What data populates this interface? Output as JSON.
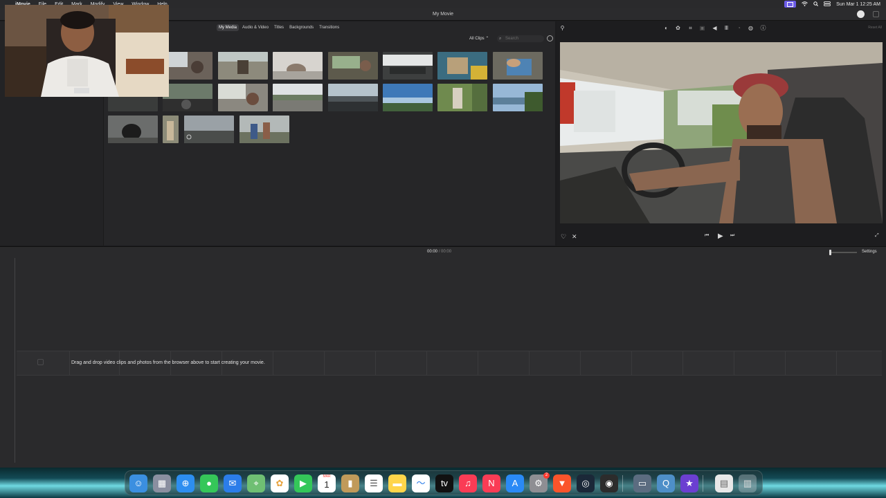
{
  "menubar": {
    "apple_icon": "apple-icon",
    "app_name": "iMovie",
    "items": [
      "File",
      "Edit",
      "Mark",
      "Modify",
      "View",
      "Window",
      "Help"
    ],
    "datetime": "Sun Mar 1  12:25 AM"
  },
  "window": {
    "title": "My Movie"
  },
  "browser": {
    "tabs": [
      {
        "label": "My Media",
        "active": true
      },
      {
        "label": "Audio & Video",
        "active": false
      },
      {
        "label": "Titles",
        "active": false
      },
      {
        "label": "Backgrounds",
        "active": false
      },
      {
        "label": "Transitions",
        "active": false
      }
    ],
    "clip_filter": "All Clips ⌃",
    "search_placeholder": "Search"
  },
  "viewer": {
    "reset_all": "Reset All"
  },
  "timeline": {
    "current_time": "00:00",
    "separator": "/",
    "total_time": "00:00",
    "settings_label": "Settings",
    "empty_message": "Drag and drop video clips and photos from the browser above to start creating your movie."
  },
  "dock": {
    "apps": [
      "finder",
      "launchpad",
      "safari",
      "messages",
      "mail",
      "maps",
      "photos",
      "facetime",
      "calendar",
      "contacts",
      "reminders",
      "notes",
      "freeform",
      "apple-tv",
      "music",
      "news",
      "app-store",
      "system-settings",
      "brave",
      "steam",
      "obs",
      "screen-sharing",
      "quicktime",
      "imovie",
      "document",
      "trash"
    ],
    "calendar_month": "MAR",
    "calendar_day": "1",
    "settings_badge": "2"
  },
  "colors": {
    "accent": "#6c5ce7",
    "panel": "#262628",
    "timeline": "#2a2a2c"
  }
}
